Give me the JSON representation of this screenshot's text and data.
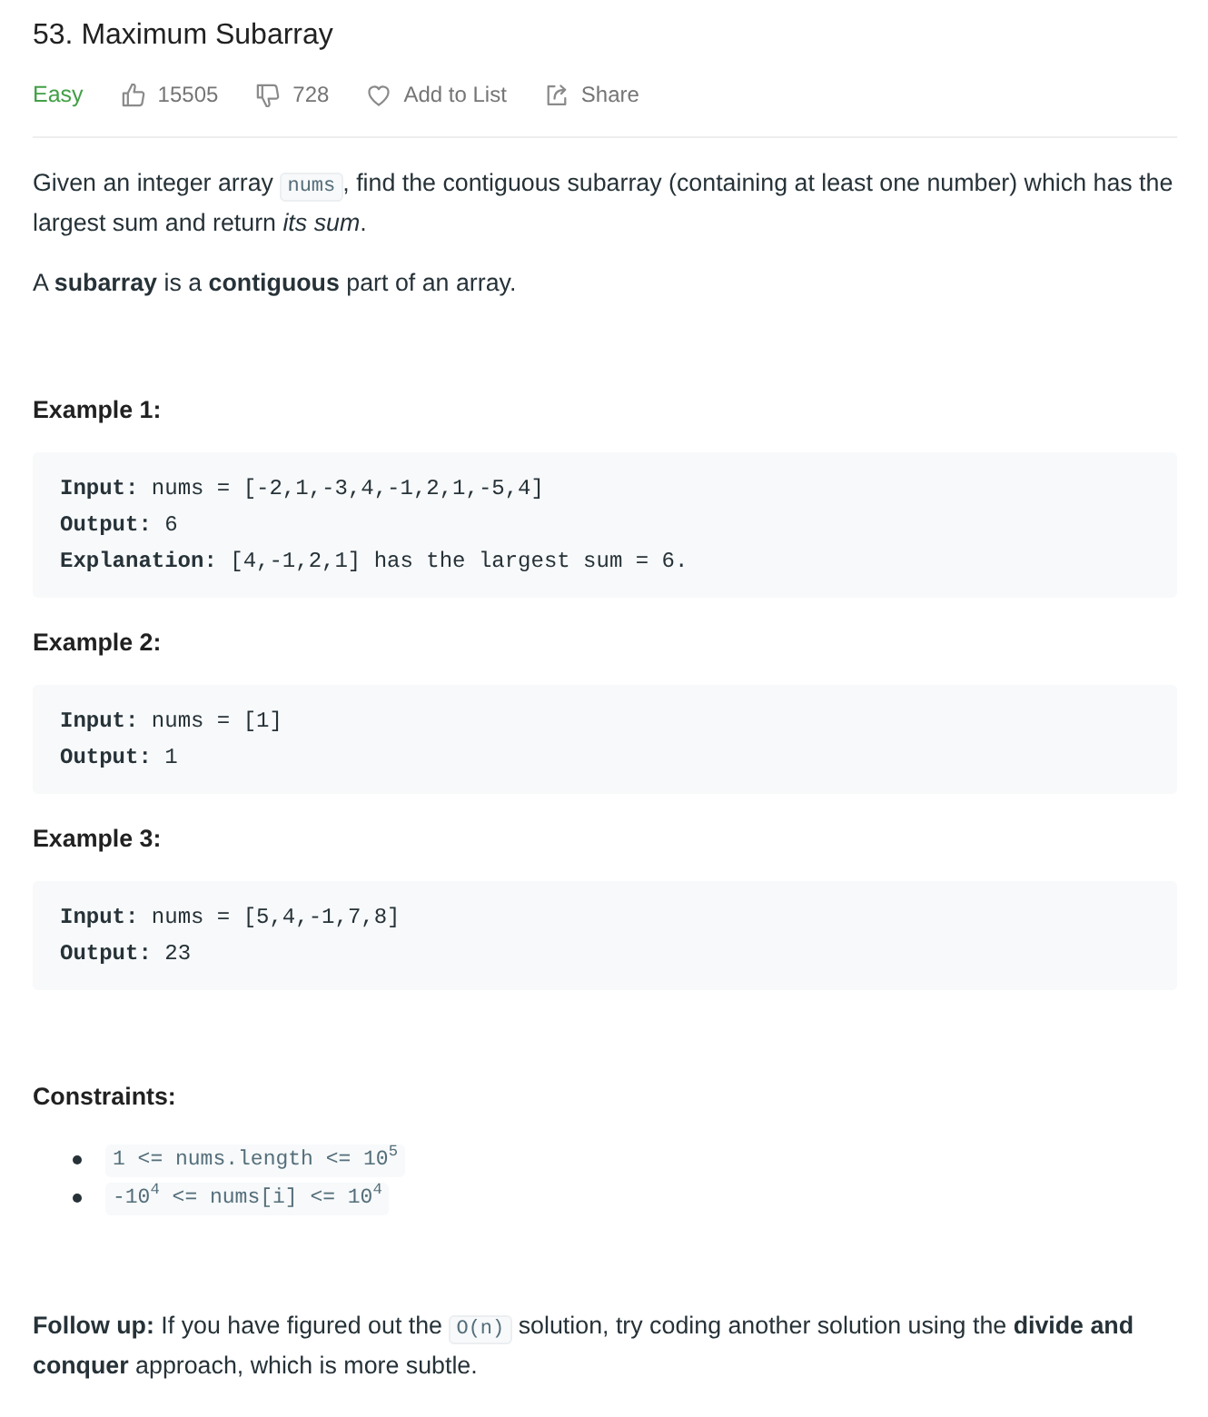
{
  "problem": {
    "title": "53. Maximum Subarray",
    "difficulty": {
      "label": "Easy",
      "kind": "easy"
    }
  },
  "actions": [
    {
      "kind": "like",
      "label": "15505"
    },
    {
      "kind": "dislike",
      "label": "728"
    },
    {
      "kind": "favorite",
      "label": "Add to List"
    },
    {
      "kind": "share",
      "label": "Share"
    }
  ],
  "description": [
    {
      "runs": [
        {
          "kind": "text",
          "text": "Given an integer array "
        },
        {
          "kind": "code",
          "text": "nums"
        },
        {
          "kind": "text",
          "text": ", find the contiguous subarray (containing at least one number) which has the largest sum and return *its sum*."
        }
      ]
    },
    {
      "runs": [
        {
          "kind": "text",
          "text": "A **subarray** is a **contiguous** part of an array."
        }
      ]
    }
  ],
  "examples": [
    {
      "title": "Example 1:",
      "lines": [
        "**Input:** nums = [-2,1,-3,4,-1,2,1,-5,4]",
        "**Output:** 6",
        "**Explanation:** [4,-1,2,1] has the largest sum = 6."
      ]
    },
    {
      "title": "Example 2:",
      "lines": [
        "**Input:** nums = [1]",
        "**Output:** 1"
      ]
    },
    {
      "title": "Example 3:",
      "lines": [
        "**Input:** nums = [5,4,-1,7,8]",
        "**Output:** 23"
      ]
    }
  ],
  "constraints": {
    "title": "Constraints:",
    "items": [
      "1 <= nums.length <= 10$^{5}$",
      "-10$^{4}$ <= nums[i] <= 10$^{4}$"
    ]
  },
  "follow_up": {
    "runs": [
      {
        "kind": "text",
        "text": "**Follow up:** If you have figured out the "
      },
      {
        "kind": "code",
        "text": "O(n)"
      },
      {
        "kind": "text",
        "text": " solution, try coding another solution using the **divide and conquer** approach, which is more subtle."
      }
    ]
  }
}
